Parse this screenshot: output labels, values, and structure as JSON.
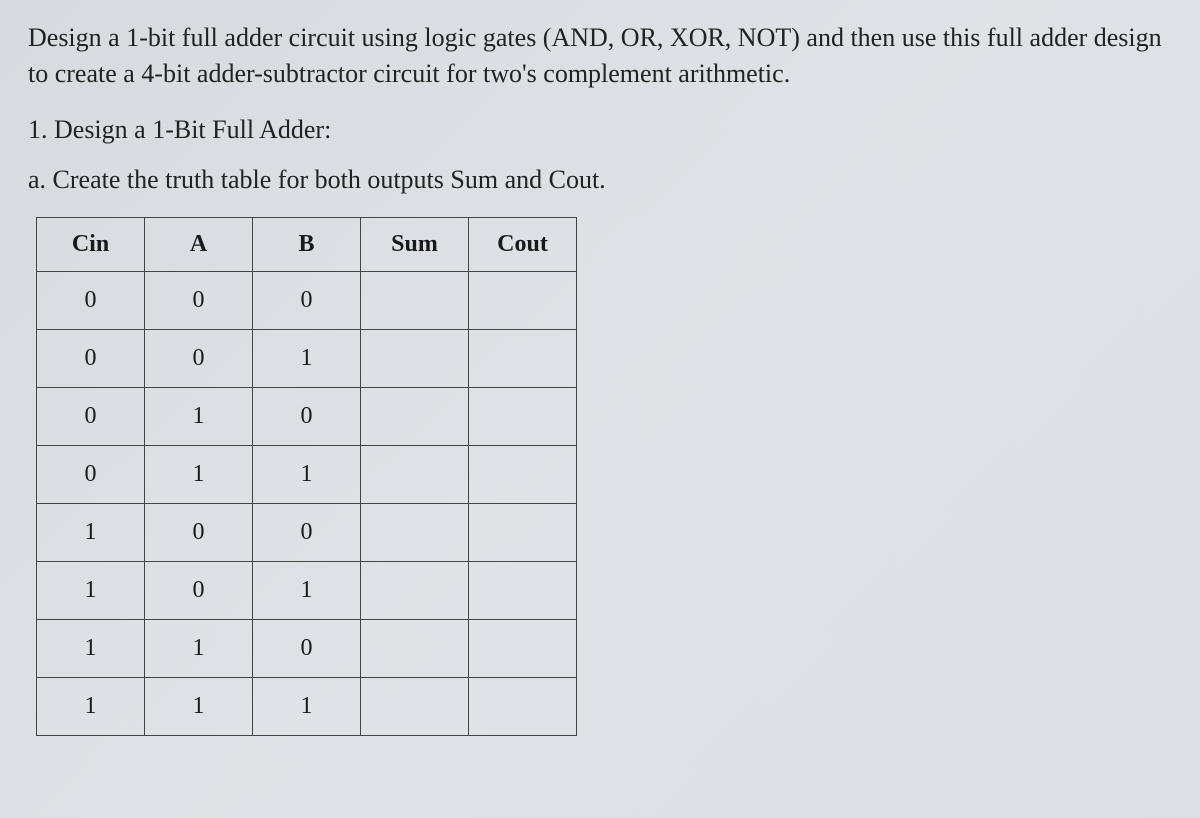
{
  "problem_statement": "Design a 1-bit full adder circuit using logic gates (AND, OR, XOR, NOT) and then use this full adder design to create a 4-bit adder-subtractor circuit for two's complement arithmetic.",
  "section_1": "1. Design a 1-Bit Full Adder:",
  "sub_a": "a. Create the truth table for both outputs Sum and Cout.",
  "table": {
    "headers": [
      "Cin",
      "A",
      "B",
      "Sum",
      "Cout"
    ],
    "rows": [
      {
        "cin": "0",
        "a": "0",
        "b": "0",
        "sum": "",
        "cout": ""
      },
      {
        "cin": "0",
        "a": "0",
        "b": "1",
        "sum": "",
        "cout": ""
      },
      {
        "cin": "0",
        "a": "1",
        "b": "0",
        "sum": "",
        "cout": ""
      },
      {
        "cin": "0",
        "a": "1",
        "b": "1",
        "sum": "",
        "cout": ""
      },
      {
        "cin": "1",
        "a": "0",
        "b": "0",
        "sum": "",
        "cout": ""
      },
      {
        "cin": "1",
        "a": "0",
        "b": "1",
        "sum": "",
        "cout": ""
      },
      {
        "cin": "1",
        "a": "1",
        "b": "0",
        "sum": "",
        "cout": ""
      },
      {
        "cin": "1",
        "a": "1",
        "b": "1",
        "sum": "",
        "cout": ""
      }
    ]
  }
}
